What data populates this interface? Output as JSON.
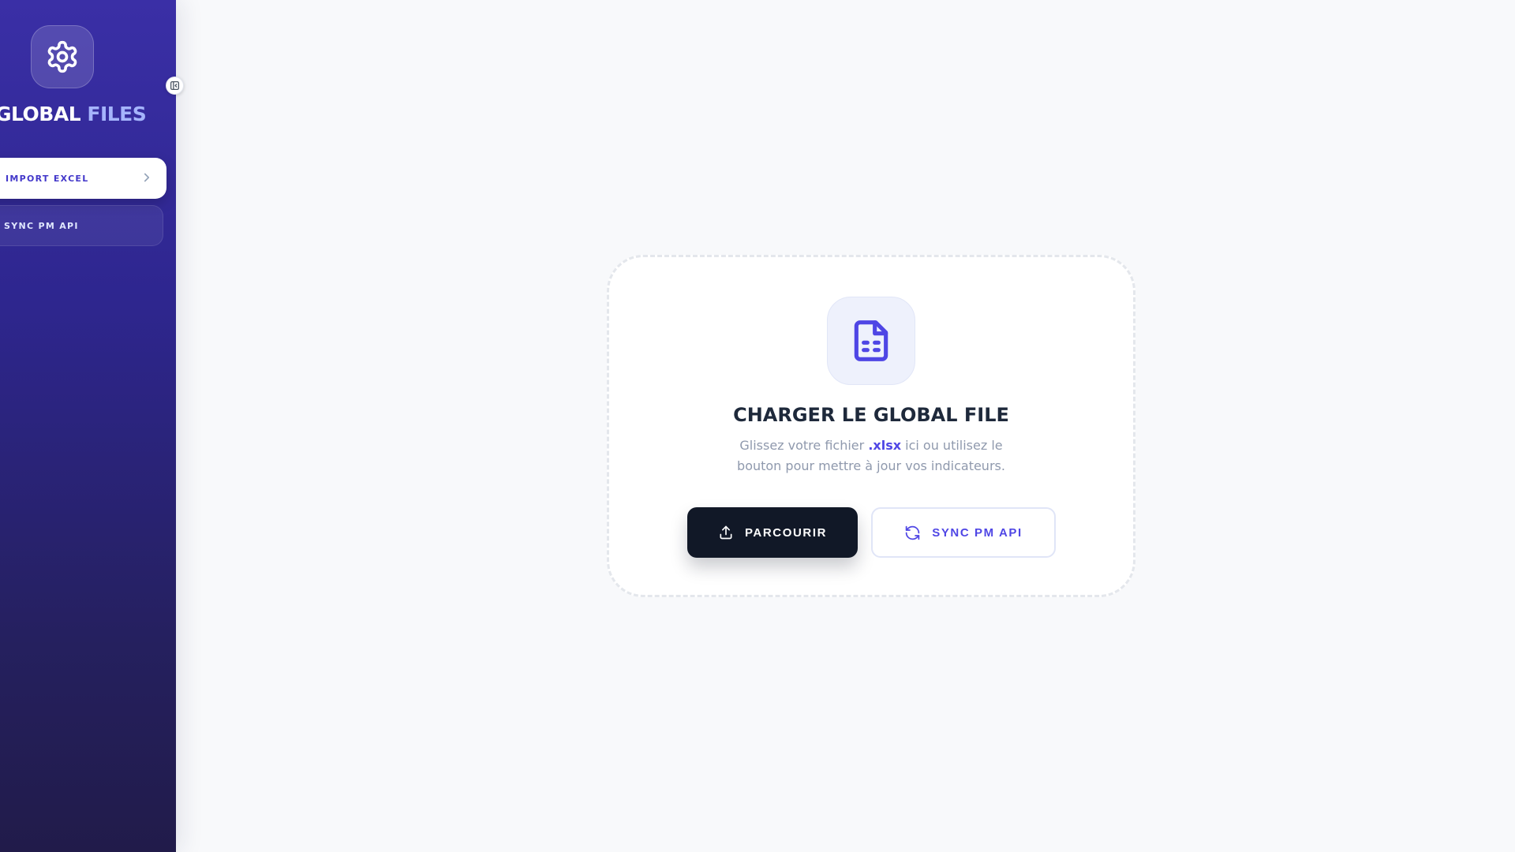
{
  "sidebar": {
    "brand_part1": "GLOBAL",
    "brand_part2": "FILES",
    "items": [
      {
        "label": "IMPORT EXCEL",
        "active": true
      },
      {
        "label": "SYNC PM API",
        "active": false
      }
    ]
  },
  "upload": {
    "title": "CHARGER LE GLOBAL FILE",
    "desc_before": "Glissez votre fichier ",
    "desc_ext": ".xlsx",
    "desc_after": " ici ou utilisez le bouton pour mettre à jour vos indicateurs.",
    "browse_label": "PARCOURIR",
    "sync_label": "SYNC PM API"
  },
  "icons": {
    "logo": "gear-icon",
    "collapse": "sidebar-collapse-icon",
    "nav_arrow": "chevron-right-icon",
    "file": "spreadsheet-file-icon",
    "browse": "upload-icon",
    "sync": "refresh-icon"
  },
  "colors": {
    "sidebar_top": "#3a2fa6",
    "sidebar_bottom": "#211b4a",
    "accent": "#4f46e5",
    "brand_highlight": "#a5b4fc",
    "primary_button": "#111827",
    "title": "#1e293b",
    "muted_text": "#8f99ad",
    "background": "#f8f9fb"
  }
}
